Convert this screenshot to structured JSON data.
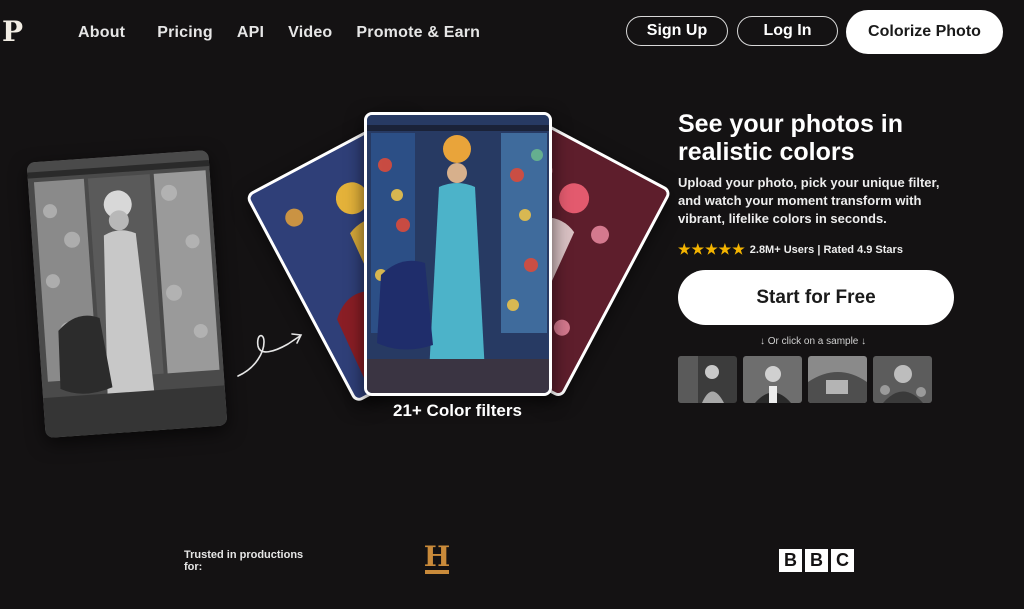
{
  "header": {
    "logo": "P",
    "nav": [
      "About",
      "Pricing",
      "API",
      "Video",
      "Promote & Earn"
    ],
    "signup_label": "Sign Up",
    "login_label": "Log In",
    "colorize_label": "Colorize Photo"
  },
  "hero": {
    "filters_caption": "21+ Color filters",
    "title": "See your photos in realistic colors",
    "subtitle": "Upload your photo, pick your unique filter, and watch your moment transform with vibrant, lifelike colors in seconds.",
    "stars": "★★★★★",
    "rating_text": "2.8M+ Users | Rated 4.9 Stars",
    "start_label": "Start for Free",
    "sample_text": "↓ Or click on a sample ↓",
    "sample_count": 4
  },
  "footer": {
    "trusted_text": "Trusted in productions for:",
    "history_letter": "H",
    "bbc_letters": [
      "B",
      "B",
      "C"
    ]
  },
  "colors": {
    "background": "#141213",
    "star": "#f4b400",
    "button_bg": "#ffffff"
  }
}
